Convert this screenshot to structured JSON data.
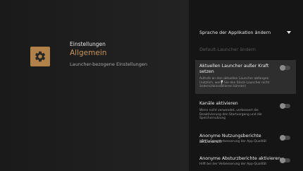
{
  "header": {
    "title": "Einstellungen",
    "section": "Allgemein",
    "description": "Launcher-bezogene Einstellungen",
    "icon": "gear-icon"
  },
  "settings_list": {
    "language": {
      "label": "Sprache der Applikation ändern",
      "icon": "chevron-down-icon"
    },
    "default_launcher": {
      "label": "Default-Launcher ändern",
      "enabled": false
    },
    "items": [
      {
        "title": "Aktuellen Launcher außer Kraft setzen",
        "description": "Aufrufe an den aktuellen Launcher abfangen (nützlich, wenn Sie den Stock-Launcher nicht ändern/deinstallieren können)",
        "checked": false,
        "focused": true
      },
      {
        "title": "Kanäle aktivieren",
        "description": "Wenn nicht verwendet, verbessert die Deaktivierung den Startvorgang und die Speichernutzung",
        "checked": false,
        "focused": false
      },
      {
        "title": "Anonyme Nutzungsberichte aktivieren",
        "description": "Hilft bei der Verbesserung der App-Qualität",
        "checked": false,
        "focused": false
      },
      {
        "title": "Anonyme Absturzberichte aktivieren",
        "description": "Hilft bei der Verbesserung der App-Qualität",
        "checked": false,
        "focused": false
      }
    ]
  },
  "colors": {
    "accent": "#c8955a",
    "tile": "#b1814a",
    "background": "#1d1d1d",
    "panel": "#151515",
    "highlight": "#2e2e2e"
  }
}
